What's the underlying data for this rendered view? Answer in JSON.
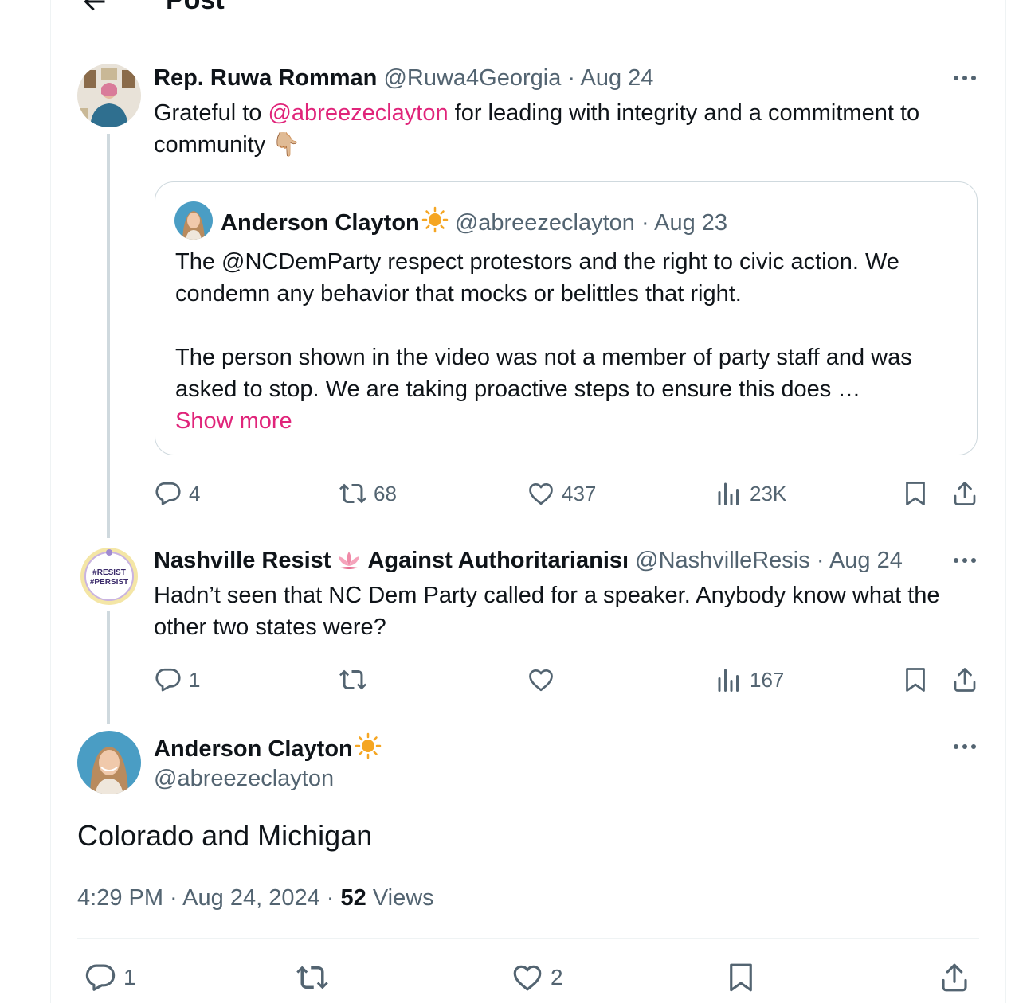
{
  "header": {
    "title": "Post"
  },
  "posts": [
    {
      "name": "Rep. Ruwa Romman",
      "handle": "@Ruwa4Georgia",
      "sep": " · ",
      "date": "Aug 24",
      "text_before": "Grateful to ",
      "mention": "@abreezeclayton",
      "text_after": " for leading with integrity and a commitment to community ",
      "emoji": "👇🏼",
      "quote": {
        "name": "Anderson Clayton",
        "handle": "@abreezeclayton",
        "sep": " · ",
        "date": "Aug 23",
        "para1": "The @NCDemParty respect protestors and the right to civic action. We condemn any behavior that mocks or belittles that right.",
        "para2": "The person shown in the video was not a member of party staff and was asked to stop. We are taking proactive steps to ensure this does …",
        "show_more": "Show more"
      },
      "stats": {
        "replies": "4",
        "reposts": "68",
        "likes": "437",
        "views": "23K"
      }
    },
    {
      "name_part1": "Nashville Resist",
      "name_part2": "Against Authoritarianisı",
      "handle": "@NashvilleResis",
      "sep": " · ",
      "date": "Aug 24",
      "avatar_text": [
        "#RESIST",
        "#PERSIST"
      ],
      "text": "Hadn’t seen that NC Dem Party called for a speaker. Anybody know what the other two states were?",
      "stats": {
        "replies": "1",
        "reposts": "",
        "likes": "",
        "views": "167"
      }
    }
  ],
  "main_post": {
    "name": "Anderson Clayton",
    "handle": "@abreezeclayton",
    "text": "Colorado and Michigan",
    "time": "4:29 PM",
    "sep": " · ",
    "date": "Aug 24, 2024",
    "views_count": "52",
    "views_label": " Views",
    "stats": {
      "replies": "1",
      "likes": "2"
    }
  },
  "colors": {
    "accent": "#e0247a",
    "secondary_text": "#536471",
    "border": "#cfd9de",
    "text": "#0f1419"
  },
  "icons": [
    "back-arrow-icon",
    "more-icon",
    "reply-icon",
    "repost-icon",
    "like-icon",
    "views-icon",
    "bookmark-icon",
    "share-icon",
    "sun-icon",
    "lotus-icon"
  ]
}
